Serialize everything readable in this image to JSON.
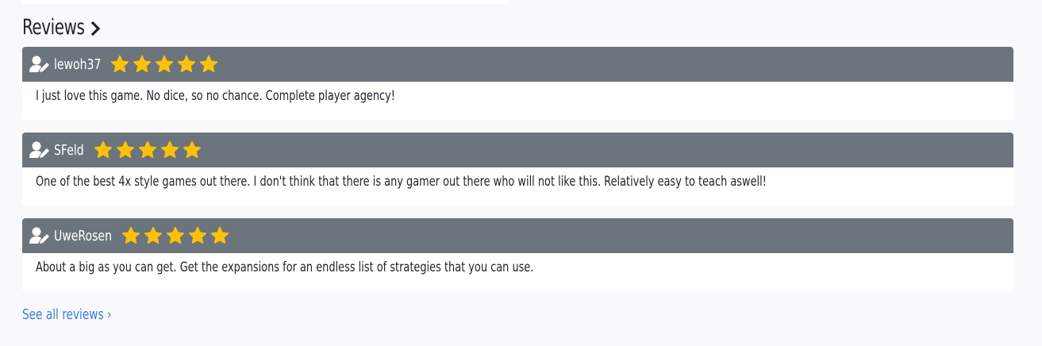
{
  "section": {
    "title": "Reviews",
    "see_all_label": "See all reviews ›"
  },
  "colors": {
    "page_background": "#f8f9fa",
    "card_header": "#6c757d",
    "card_body": "#ffffff",
    "star": "#ffc107",
    "link": "#3b7ddd"
  },
  "reviews": [
    {
      "username": "lewoh37",
      "rating": 5,
      "max_rating": 5,
      "text": "I just love this game. No dice, so no chance. Complete player agency!"
    },
    {
      "username": "SFeld",
      "rating": 5,
      "max_rating": 5,
      "text": "One of the best 4x style games out there. I don't think that there is any gamer out there who will not like this. Relatively easy to teach aswell!"
    },
    {
      "username": "UweRosen",
      "rating": 5,
      "max_rating": 5,
      "text": "About a big as you can get. Get the expansions for an endless list of strategies that you can use."
    }
  ]
}
